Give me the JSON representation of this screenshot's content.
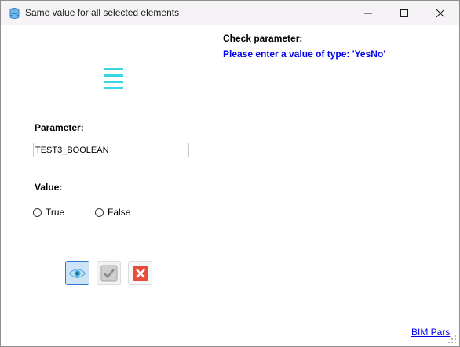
{
  "window": {
    "title": "Same value for all selected elements",
    "app_icon": "database-icon",
    "controls": [
      "minimize-icon",
      "maximize-icon",
      "close-icon"
    ]
  },
  "check": {
    "label": "Check parameter:",
    "message": "Please enter a value of type: 'YesNo'"
  },
  "logo": {
    "icon": "menu-lines-icon",
    "color": "#3ad6e6"
  },
  "parameter": {
    "label": "Parameter:",
    "value": "TEST3_BOOLEAN"
  },
  "value_section": {
    "label": "Value:",
    "options": [
      {
        "label": "True",
        "selected": false
      },
      {
        "label": "False",
        "selected": false
      }
    ]
  },
  "actions": {
    "preview_icon": "eye-icon",
    "apply_icon": "checkmark-icon",
    "cancel_icon": "x-icon",
    "cancel_color": "#e84c3d"
  },
  "footer": {
    "link": "BIM Pars"
  }
}
